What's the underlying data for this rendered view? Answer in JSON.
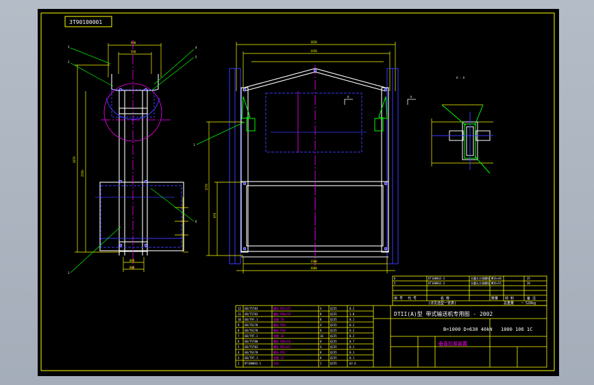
{
  "drawing_number": "3T90100001",
  "labels": {
    "ann1": "1",
    "ann2": "2",
    "ann3": "3",
    "ann4": "4",
    "ann5": "5",
    "ann6": "6",
    "section_left": "A",
    "section_right": "A",
    "section_view": "A - A"
  },
  "dims": {
    "side_top_width": "900",
    "side_inner_width": "560",
    "side_bottom_width": "890",
    "side_base_width": "800",
    "side_total_height": "2870",
    "side_upper_height": "2550",
    "front_total_width": "1820",
    "front_inner_width": "1450",
    "front_bottom_width": "1300",
    "front_base_width": "1600",
    "front_height": "1570",
    "front_lower_height": "870"
  },
  "title_block": {
    "series": "DTII(A)型  带式输送机专用图 - 2002",
    "spec": "B=1000 D=630 40kN",
    "doc_no": "1000 106 1C",
    "name": "垂直拉紧装置",
    "header_cols": [
      "序 号",
      "代 号",
      "名   称",
      "数量",
      "材 料",
      "备 注"
    ],
    "total_weight_label": "总重量",
    "total_weight": "~ 528kg",
    "notes": "(详见选型一览表)",
    "top_rows": [
      [
        "6",
        "DT1000G2-3",
        "半圆头方颈螺栓 M16×40",
        "4",
        "",
        "35"
      ],
      [
        "5",
        "DT1000G2-3",
        "半圆头方颈螺栓 M16×55",
        "4",
        "",
        "38"
      ]
    ],
    "parts_rows": [
      [
        "12",
        "GB/T5783",
        "螺栓 M12×35",
        "4",
        "Q235",
        "0.2"
      ],
      [
        "11",
        "GB/T5783",
        "螺栓 M20×70",
        "8",
        "Q235",
        "3.8"
      ],
      [
        "10",
        "GB/T97.1",
        "垫圈 20",
        "8",
        "Q235",
        "0.1"
      ],
      [
        "9",
        "GB/T6170",
        "螺母 M20",
        "4",
        "Q235",
        "0.2"
      ],
      [
        "8",
        "GB/T6170",
        "螺母 M16",
        "8",
        "Q235",
        "0.2"
      ],
      [
        "7",
        "GB/T97.1",
        "垫圈 16",
        "16",
        "Q235",
        "0.2"
      ],
      [
        "6",
        "GB/T5780",
        "螺栓 M16×50",
        "8",
        "Q235",
        "0.7"
      ],
      [
        "5",
        "GB/T5783",
        "螺栓 M12×45",
        "4",
        "Q235",
        "0.2"
      ],
      [
        "4",
        "GB/T6170",
        "螺母 M12",
        "8",
        "Q235",
        "0.1"
      ],
      [
        "3",
        "GB/T97.1",
        "垫圈 12",
        "8",
        "Q235",
        "0.1"
      ],
      [
        "2",
        "DT1000G2-1",
        "导轨",
        "2",
        "Q235",
        "62.6"
      ]
    ]
  },
  "colors": {
    "paper": "#000000",
    "line_white": "#ffffff",
    "line_yellow": "#ffff00",
    "line_magenta": "#ff00ff",
    "line_green": "#00ff00",
    "line_blue": "#3a3aff",
    "frame_yellow": "#ffff00"
  }
}
